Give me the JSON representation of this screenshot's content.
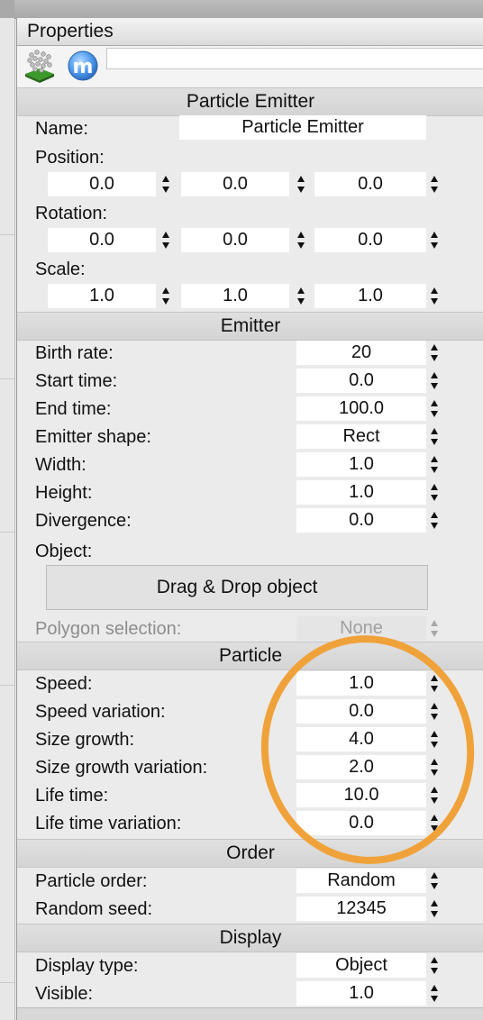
{
  "panel": {
    "title": "Properties"
  },
  "toolbar": {
    "icons": [
      "particle-emitter-icon",
      "m-icon"
    ],
    "search_value": ""
  },
  "particle_emitter": {
    "header": "Particle Emitter",
    "name_label": "Name:",
    "name_value": "Particle Emitter",
    "position_label": "Position:",
    "position": [
      "0.0",
      "0.0",
      "0.0"
    ],
    "rotation_label": "Rotation:",
    "rotation": [
      "0.0",
      "0.0",
      "0.0"
    ],
    "scale_label": "Scale:",
    "scale": [
      "1.0",
      "1.0",
      "1.0"
    ]
  },
  "emitter": {
    "header": "Emitter",
    "rows": [
      {
        "label": "Birth rate:",
        "value": "20"
      },
      {
        "label": "Start time:",
        "value": "0.0"
      },
      {
        "label": "End time:",
        "value": "100.0"
      },
      {
        "label": "Emitter shape:",
        "value": "Rect"
      },
      {
        "label": "Width:",
        "value": "1.0"
      },
      {
        "label": "Height:",
        "value": "1.0"
      },
      {
        "label": "Divergence:",
        "value": "0.0"
      }
    ],
    "object_label": "Object:",
    "drop_label": "Drag & Drop object",
    "polygon_label": "Polygon selection:",
    "polygon_value": "None"
  },
  "particle": {
    "header": "Particle",
    "rows": [
      {
        "label": "Speed:",
        "value": "1.0"
      },
      {
        "label": "Speed variation:",
        "value": "0.0"
      },
      {
        "label": "Size growth:",
        "value": "4.0"
      },
      {
        "label": "Size growth variation:",
        "value": "2.0"
      },
      {
        "label": "Life time:",
        "value": "10.0"
      },
      {
        "label": "Life time variation:",
        "value": "0.0"
      }
    ]
  },
  "order": {
    "header": "Order",
    "rows": [
      {
        "label": "Particle order:",
        "value": "Random"
      },
      {
        "label": "Random seed:",
        "value": "12345"
      }
    ]
  },
  "display": {
    "header": "Display",
    "rows": [
      {
        "label": "Display type:",
        "value": "Object"
      },
      {
        "label": "Visible:",
        "value": "1.0"
      }
    ]
  },
  "colors": {
    "highlight": "#f0a23a"
  }
}
